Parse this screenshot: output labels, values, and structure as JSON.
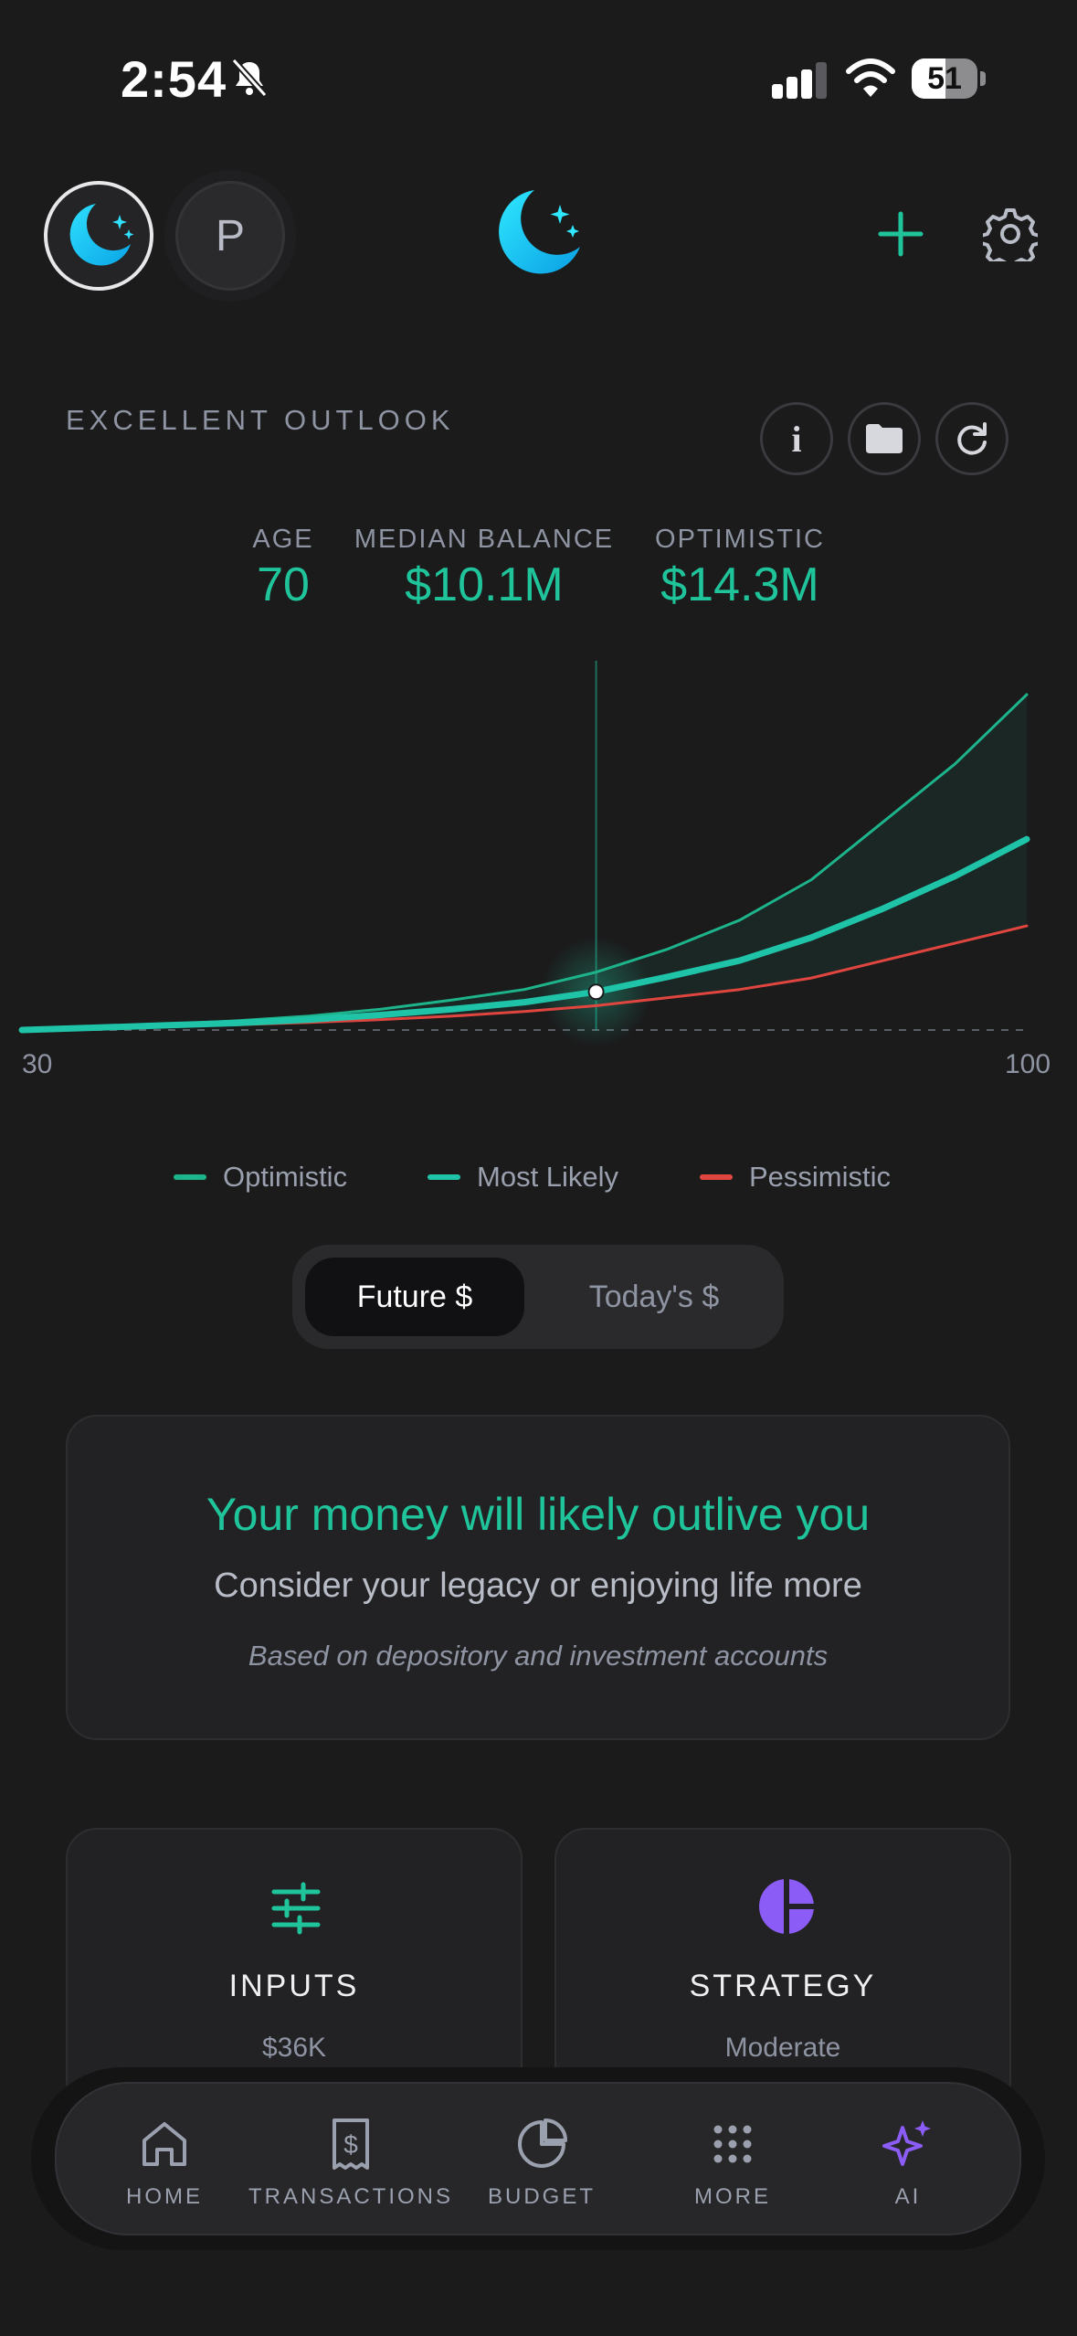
{
  "status_bar": {
    "time": "2:54",
    "battery": "51",
    "battery_fraction": 0.51
  },
  "header": {
    "avatar_initial": "P"
  },
  "outlook": {
    "label": "EXCELLENT OUTLOOK"
  },
  "stats": {
    "age_label": "AGE",
    "age_value": "70",
    "median_label": "MEDIAN BALANCE",
    "median_value": "$10.1M",
    "optimistic_label": "OPTIMISTIC",
    "optimistic_value": "$14.3M"
  },
  "chart_data": {
    "type": "line",
    "x_tick_labels": [
      "30",
      "100"
    ],
    "xlim": [
      30,
      100
    ],
    "selected_x": 70,
    "x": [
      30,
      35,
      40,
      45,
      50,
      55,
      60,
      65,
      70,
      75,
      80,
      85,
      90,
      95,
      100
    ],
    "series": [
      {
        "name": "Optimistic",
        "color": "#1db48c",
        "values": [
          0,
          0.25,
          0.5,
          0.8,
          1.2,
          1.8,
          2.6,
          3.5,
          5.0,
          7.0,
          9.5,
          13.0,
          18.0,
          23.0,
          29.0
        ]
      },
      {
        "name": "Most Likely",
        "color": "#1fc4a8",
        "values": [
          0,
          0.2,
          0.4,
          0.6,
          0.9,
          1.3,
          1.8,
          2.4,
          3.3,
          4.6,
          6.0,
          8.0,
          10.5,
          13.3,
          16.5
        ]
      },
      {
        "name": "Pessimistic",
        "color": "#e0463f",
        "values": [
          0,
          0.15,
          0.3,
          0.45,
          0.65,
          0.9,
          1.2,
          1.6,
          2.1,
          2.8,
          3.5,
          4.5,
          6.0,
          7.5,
          9.0
        ]
      }
    ]
  },
  "legend": {
    "optimistic": "Optimistic",
    "most_likely": "Most Likely",
    "pessimistic": "Pessimistic"
  },
  "toggle": {
    "future": "Future $",
    "today": "Today's $"
  },
  "summary": {
    "headline": "Your money will likely outlive you",
    "subtext": "Consider your legacy or enjoying life more",
    "note": "Based on depository and investment accounts"
  },
  "tiles": {
    "inputs_title": "INPUTS",
    "inputs_value": "$36K",
    "strategy_title": "STRATEGY",
    "strategy_value": "Moderate"
  },
  "nav": {
    "home": "HOME",
    "transactions": "TRANSACTIONS",
    "budget": "BUDGET",
    "more": "MORE",
    "ai": "AI"
  },
  "colors": {
    "accent": "#1fc49b",
    "pessimistic": "#e0463f",
    "ai_purple": "#8b5cf6",
    "moon_cyan": "#18c8f0"
  }
}
